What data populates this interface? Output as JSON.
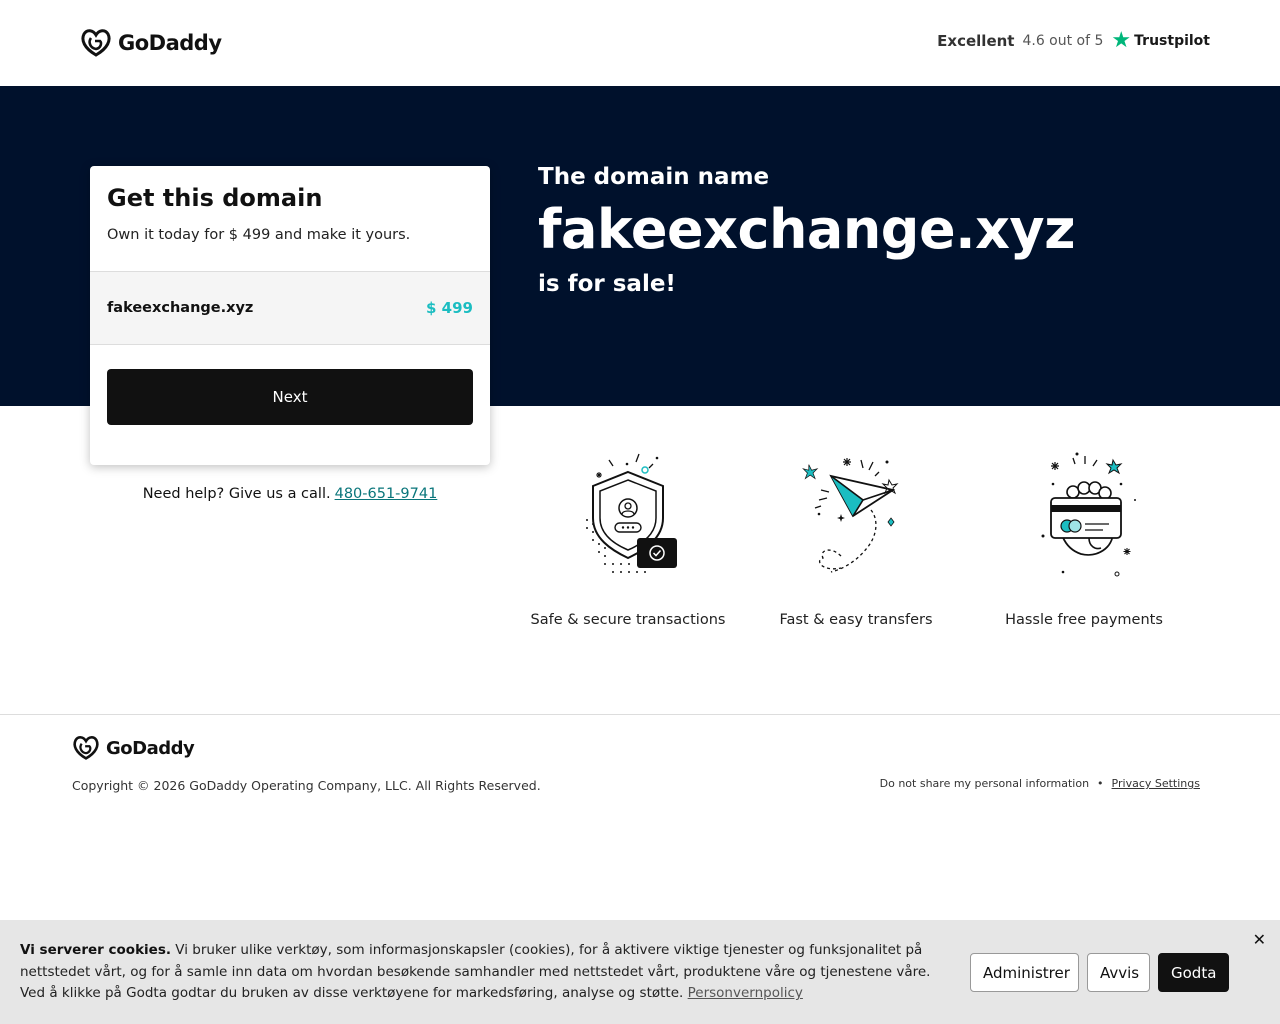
{
  "header": {
    "logo_text": "GoDaddy",
    "trust": {
      "rating_word": "Excellent",
      "score": "4.6 out of 5",
      "brand": "Trustpilot"
    }
  },
  "hero": {
    "pre": "The domain name",
    "domain": "fakeexchange.xyz",
    "post": "is for sale!"
  },
  "card": {
    "title": "Get this domain",
    "subtitle": "Own it today for $ 499 and make it yours.",
    "domain": "fakeexchange.xyz",
    "price": "$ 499",
    "next_label": "Next"
  },
  "help": {
    "text": "Need help? Give us a call.",
    "phone": "480-651-9741"
  },
  "features": [
    {
      "label": "Safe & secure transactions",
      "icon": "shield-icon"
    },
    {
      "label": "Fast & easy transfers",
      "icon": "paper-plane-icon"
    },
    {
      "label": "Hassle free payments",
      "icon": "card-hand-icon"
    }
  ],
  "footer": {
    "logo_text": "GoDaddy",
    "copyright": "Copyright © 2026 GoDaddy Operating Company, LLC. All Rights Reserved.",
    "dont_share": "Do not share my personal information",
    "privacy": "Privacy Settings"
  },
  "cookie": {
    "heading": "Vi serverer cookies.",
    "body": "Vi bruker ulike verktøy, som informasjonskapsler (cookies), for å aktivere viktige tjenester og funksjonalitet på nettstedet vårt, og for å samle inn data om hvordan besøkende samhandler med nettstedet vårt, produktene våre og tjenestene våre. Ved å klikke på Godta godtar du bruken av disse verktøyene for markedsføring, analyse og støtte.",
    "policy_link": "Personvernpolicy",
    "manage_label": "Administrer",
    "reject_label": "Avvis",
    "accept_label": "Godta",
    "close_glyph": "✕"
  },
  "colors": {
    "hero_bg": "#00112c",
    "accent_teal": "#1bbdc1",
    "link_teal": "#09757a",
    "trustpilot_green": "#00b67a"
  }
}
